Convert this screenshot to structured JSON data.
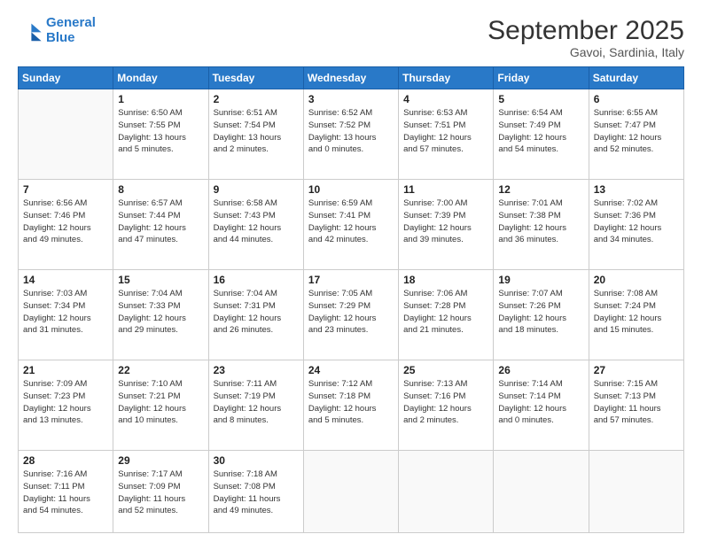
{
  "header": {
    "logo_line1": "General",
    "logo_line2": "Blue",
    "month": "September 2025",
    "location": "Gavoi, Sardinia, Italy"
  },
  "weekdays": [
    "Sunday",
    "Monday",
    "Tuesday",
    "Wednesday",
    "Thursday",
    "Friday",
    "Saturday"
  ],
  "weeks": [
    [
      {
        "day": "",
        "info": ""
      },
      {
        "day": "1",
        "info": "Sunrise: 6:50 AM\nSunset: 7:55 PM\nDaylight: 13 hours\nand 5 minutes."
      },
      {
        "day": "2",
        "info": "Sunrise: 6:51 AM\nSunset: 7:54 PM\nDaylight: 13 hours\nand 2 minutes."
      },
      {
        "day": "3",
        "info": "Sunrise: 6:52 AM\nSunset: 7:52 PM\nDaylight: 13 hours\nand 0 minutes."
      },
      {
        "day": "4",
        "info": "Sunrise: 6:53 AM\nSunset: 7:51 PM\nDaylight: 12 hours\nand 57 minutes."
      },
      {
        "day": "5",
        "info": "Sunrise: 6:54 AM\nSunset: 7:49 PM\nDaylight: 12 hours\nand 54 minutes."
      },
      {
        "day": "6",
        "info": "Sunrise: 6:55 AM\nSunset: 7:47 PM\nDaylight: 12 hours\nand 52 minutes."
      }
    ],
    [
      {
        "day": "7",
        "info": "Sunrise: 6:56 AM\nSunset: 7:46 PM\nDaylight: 12 hours\nand 49 minutes."
      },
      {
        "day": "8",
        "info": "Sunrise: 6:57 AM\nSunset: 7:44 PM\nDaylight: 12 hours\nand 47 minutes."
      },
      {
        "day": "9",
        "info": "Sunrise: 6:58 AM\nSunset: 7:43 PM\nDaylight: 12 hours\nand 44 minutes."
      },
      {
        "day": "10",
        "info": "Sunrise: 6:59 AM\nSunset: 7:41 PM\nDaylight: 12 hours\nand 42 minutes."
      },
      {
        "day": "11",
        "info": "Sunrise: 7:00 AM\nSunset: 7:39 PM\nDaylight: 12 hours\nand 39 minutes."
      },
      {
        "day": "12",
        "info": "Sunrise: 7:01 AM\nSunset: 7:38 PM\nDaylight: 12 hours\nand 36 minutes."
      },
      {
        "day": "13",
        "info": "Sunrise: 7:02 AM\nSunset: 7:36 PM\nDaylight: 12 hours\nand 34 minutes."
      }
    ],
    [
      {
        "day": "14",
        "info": "Sunrise: 7:03 AM\nSunset: 7:34 PM\nDaylight: 12 hours\nand 31 minutes."
      },
      {
        "day": "15",
        "info": "Sunrise: 7:04 AM\nSunset: 7:33 PM\nDaylight: 12 hours\nand 29 minutes."
      },
      {
        "day": "16",
        "info": "Sunrise: 7:04 AM\nSunset: 7:31 PM\nDaylight: 12 hours\nand 26 minutes."
      },
      {
        "day": "17",
        "info": "Sunrise: 7:05 AM\nSunset: 7:29 PM\nDaylight: 12 hours\nand 23 minutes."
      },
      {
        "day": "18",
        "info": "Sunrise: 7:06 AM\nSunset: 7:28 PM\nDaylight: 12 hours\nand 21 minutes."
      },
      {
        "day": "19",
        "info": "Sunrise: 7:07 AM\nSunset: 7:26 PM\nDaylight: 12 hours\nand 18 minutes."
      },
      {
        "day": "20",
        "info": "Sunrise: 7:08 AM\nSunset: 7:24 PM\nDaylight: 12 hours\nand 15 minutes."
      }
    ],
    [
      {
        "day": "21",
        "info": "Sunrise: 7:09 AM\nSunset: 7:23 PM\nDaylight: 12 hours\nand 13 minutes."
      },
      {
        "day": "22",
        "info": "Sunrise: 7:10 AM\nSunset: 7:21 PM\nDaylight: 12 hours\nand 10 minutes."
      },
      {
        "day": "23",
        "info": "Sunrise: 7:11 AM\nSunset: 7:19 PM\nDaylight: 12 hours\nand 8 minutes."
      },
      {
        "day": "24",
        "info": "Sunrise: 7:12 AM\nSunset: 7:18 PM\nDaylight: 12 hours\nand 5 minutes."
      },
      {
        "day": "25",
        "info": "Sunrise: 7:13 AM\nSunset: 7:16 PM\nDaylight: 12 hours\nand 2 minutes."
      },
      {
        "day": "26",
        "info": "Sunrise: 7:14 AM\nSunset: 7:14 PM\nDaylight: 12 hours\nand 0 minutes."
      },
      {
        "day": "27",
        "info": "Sunrise: 7:15 AM\nSunset: 7:13 PM\nDaylight: 11 hours\nand 57 minutes."
      }
    ],
    [
      {
        "day": "28",
        "info": "Sunrise: 7:16 AM\nSunset: 7:11 PM\nDaylight: 11 hours\nand 54 minutes."
      },
      {
        "day": "29",
        "info": "Sunrise: 7:17 AM\nSunset: 7:09 PM\nDaylight: 11 hours\nand 52 minutes."
      },
      {
        "day": "30",
        "info": "Sunrise: 7:18 AM\nSunset: 7:08 PM\nDaylight: 11 hours\nand 49 minutes."
      },
      {
        "day": "",
        "info": ""
      },
      {
        "day": "",
        "info": ""
      },
      {
        "day": "",
        "info": ""
      },
      {
        "day": "",
        "info": ""
      }
    ]
  ]
}
